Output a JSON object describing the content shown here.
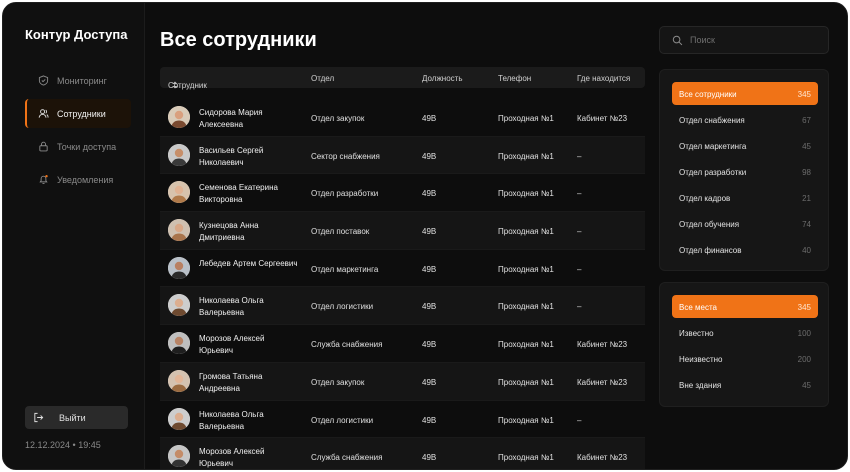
{
  "app": {
    "title": "Контур Доступа"
  },
  "sidebar": {
    "items": [
      {
        "label": "Мониторинг",
        "icon": "shield-icon",
        "active": false
      },
      {
        "label": "Сотрудники",
        "icon": "user-icon",
        "active": true
      },
      {
        "label": "Точки доступа",
        "icon": "lock-icon",
        "active": false
      },
      {
        "label": "Уведомления",
        "icon": "bell-icon",
        "active": false
      }
    ],
    "logout_label": "Выйти",
    "datetime": "12.12.2024 • 19:45"
  },
  "main": {
    "title": "Все сотрудники",
    "columns": {
      "employee": "Сотрудник",
      "department": "Отдел",
      "position": "Должность",
      "phone": "Телефон",
      "location": "Где находится"
    },
    "rows": [
      {
        "name": "Сидорова Мария Алексеевна",
        "department": "Отдел закупок",
        "position": "49B",
        "phone": "Проходная №1",
        "location": "Кабинет №23"
      },
      {
        "name": "Васильев Сергей Николаевич",
        "department": "Сектор снабжения",
        "position": "49B",
        "phone": "Проходная №1",
        "location": "–"
      },
      {
        "name": "Семенова Екатерина Викторовна",
        "department": "Отдел разработки",
        "position": "49B",
        "phone": "Проходная №1",
        "location": "–"
      },
      {
        "name": "Кузнецова Анна Дмитриевна",
        "department": "Отдел поставок",
        "position": "49B",
        "phone": "Проходная №1",
        "location": "–"
      },
      {
        "name": "Лебедев Артем Сергеевич",
        "department": "Отдел маркетинга",
        "position": "49B",
        "phone": "Проходная №1",
        "location": "–"
      },
      {
        "name": "Николаева Ольга Валерьевна",
        "department": "Отдел логистики",
        "position": "49B",
        "phone": "Проходная №1",
        "location": "–"
      },
      {
        "name": "Морозов Алексей Юрьевич",
        "department": "Служба снабжения",
        "position": "49B",
        "phone": "Проходная №1",
        "location": "Кабинет №23"
      },
      {
        "name": "Громова Татьяна Андреевна",
        "department": "Отдел закупок",
        "position": "49B",
        "phone": "Проходная №1",
        "location": "Кабинет №23"
      },
      {
        "name": "Николаева Ольга Валерьевна",
        "department": "Отдел логистики",
        "position": "49B",
        "phone": "Проходная №1",
        "location": "–"
      },
      {
        "name": "Морозов Алексей Юрьевич",
        "department": "Служба снабжения",
        "position": "49B",
        "phone": "Проходная №1",
        "location": "Кабинет №23"
      }
    ]
  },
  "search": {
    "placeholder": "Поиск",
    "value": ""
  },
  "department_filters": [
    {
      "label": "Все сотрудники",
      "count": "345",
      "active": true
    },
    {
      "label": "Отдел снабжения",
      "count": "67",
      "active": false
    },
    {
      "label": "Отдел маркетинга",
      "count": "45",
      "active": false
    },
    {
      "label": "Отдел разработки",
      "count": "98",
      "active": false
    },
    {
      "label": "Отдел кадров",
      "count": "21",
      "active": false
    },
    {
      "label": "Отдел обучения",
      "count": "74",
      "active": false
    },
    {
      "label": "Отдел финансов",
      "count": "40",
      "active": false
    }
  ],
  "location_filters": [
    {
      "label": "Все места",
      "count": "345",
      "active": true
    },
    {
      "label": "Известно",
      "count": "100",
      "active": false
    },
    {
      "label": "Неизвестно",
      "count": "200",
      "active": false
    },
    {
      "label": "Вне здания",
      "count": "45",
      "active": false
    }
  ],
  "colors": {
    "accent": "#f07317",
    "background": "#0d0d0d",
    "panel": "#161616"
  }
}
